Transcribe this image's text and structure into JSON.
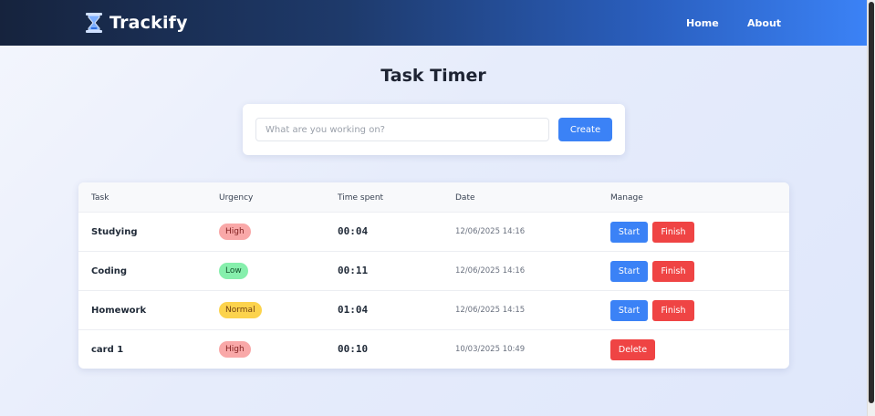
{
  "nav": {
    "brand": "Trackify",
    "brand_icon": "hourglass-icon",
    "links": [
      {
        "label": "Home"
      },
      {
        "label": "About"
      }
    ]
  },
  "page": {
    "title": "Task Timer"
  },
  "create": {
    "placeholder": "What are you working on?",
    "value": "",
    "button_label": "Create"
  },
  "table": {
    "headers": [
      "Task",
      "Urgency",
      "Time spent",
      "Date",
      "Manage"
    ],
    "rows": [
      {
        "task": "Studying",
        "urgency": "High",
        "time": "00:04",
        "date": "12/06/2025 14:16",
        "actions": [
          "Start",
          "Finish"
        ]
      },
      {
        "task": "Coding",
        "urgency": "Low",
        "time": "00:11",
        "date": "12/06/2025 14:16",
        "actions": [
          "Start",
          "Finish"
        ]
      },
      {
        "task": "Homework",
        "urgency": "Normal",
        "time": "01:04",
        "date": "12/06/2025 14:15",
        "actions": [
          "Start",
          "Finish"
        ]
      },
      {
        "task": "card 1",
        "urgency": "High",
        "time": "00:10",
        "date": "10/03/2025 10:49",
        "actions": [
          "Delete"
        ]
      }
    ]
  },
  "colors": {
    "primary": "#3b82f6",
    "danger": "#ef4444",
    "urgency_high": "#f9a8a8",
    "urgency_low": "#86efac",
    "urgency_normal": "#fcd34d"
  }
}
